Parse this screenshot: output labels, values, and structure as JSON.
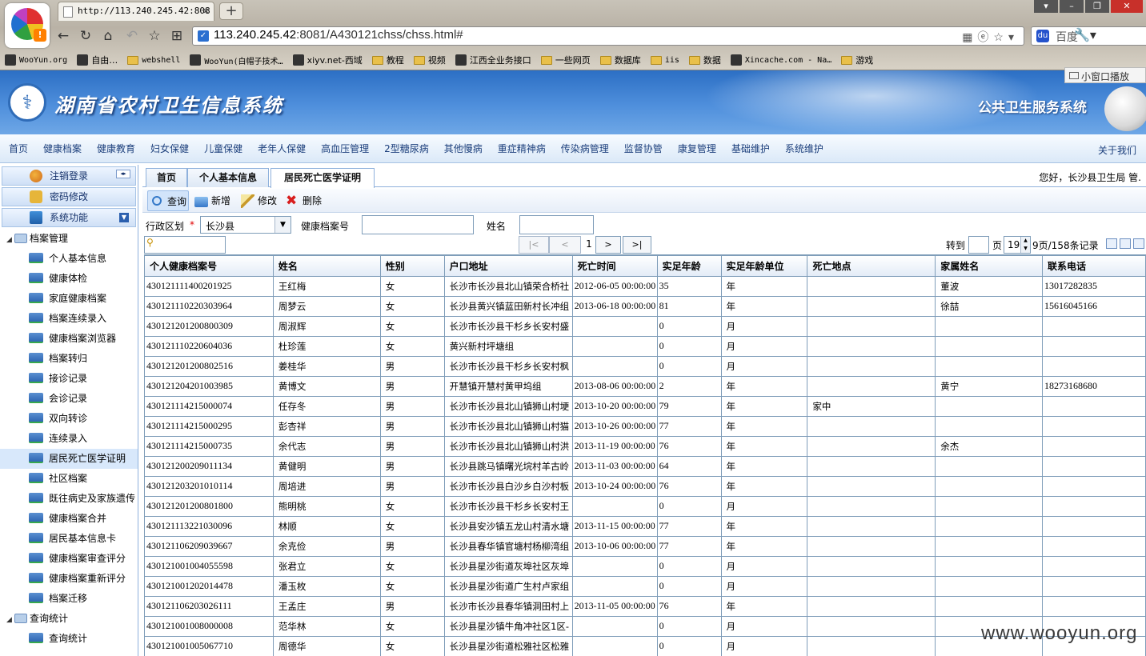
{
  "browser": {
    "tab_title": "http://113.240.245.42:808",
    "url_host": "113.240.245.42",
    "url_rest": ":8081/A430121chss/chss.html#",
    "search_placeholder": "百度",
    "bookmarks": [
      {
        "label": "WooYun.org",
        "type": "site",
        "mono": true
      },
      {
        "label": "自由…",
        "type": "site",
        "mono": false
      },
      {
        "label": "webshell",
        "type": "folder",
        "mono": true
      },
      {
        "label": "WooYun(白帽子技术…",
        "type": "site",
        "mono": true
      },
      {
        "label": "xiyv.net-西域",
        "type": "site",
        "mono": false
      },
      {
        "label": "教程",
        "type": "folder",
        "mono": false
      },
      {
        "label": "视频",
        "type": "folder",
        "mono": false
      },
      {
        "label": "江西全业务接口",
        "type": "site",
        "mono": false
      },
      {
        "label": "一些网页",
        "type": "folder",
        "mono": false
      },
      {
        "label": "数据库",
        "type": "folder",
        "mono": false
      },
      {
        "label": "iis",
        "type": "folder",
        "mono": true
      },
      {
        "label": "数据",
        "type": "folder",
        "mono": false
      },
      {
        "label": "Xincache.com - Na…",
        "type": "site",
        "mono": true
      },
      {
        "label": "游戏",
        "type": "folder",
        "mono": false
      }
    ],
    "mini_play": "小窗口播放"
  },
  "header": {
    "title": "湖南省农村卫生信息系统",
    "subtitle": "公共卫生服务系统"
  },
  "menu": {
    "items": [
      "首页",
      "健康档案",
      "健康教育",
      "妇女保健",
      "儿童保健",
      "老年人保健",
      "高血压管理",
      "2型糖尿病",
      "其他慢病",
      "重症精神病",
      "传染病管理",
      "监督协管",
      "康复管理",
      "基础维护",
      "系统维护"
    ],
    "about": "关于我们"
  },
  "sidebar": {
    "logout": "注销登录",
    "change_password": "密码修改",
    "system_functions": "系统功能",
    "group1": "档案管理",
    "items": [
      "个人基本信息",
      "健康体检",
      "家庭健康档案",
      "档案连续录入",
      "健康档案浏览器",
      "档案转归",
      "接诊记录",
      "会诊记录",
      "双向转诊",
      "连续录入",
      "居民死亡医学证明",
      "社区档案",
      "既往病史及家族遗传",
      "健康档案合并",
      "居民基本信息卡",
      "健康档案审查评分",
      "健康档案重新评分",
      "档案迁移"
    ],
    "selected_index": 10,
    "group2": "查询统计",
    "items2": [
      "查询统计"
    ]
  },
  "tabs": {
    "items": [
      "首页",
      "个人基本信息",
      "居民死亡医学证明"
    ],
    "active": 2,
    "welcome": "您好，长沙县卫生局 管."
  },
  "toolbar": {
    "query": "查询",
    "add": "新增",
    "edit": "修改",
    "delete": "删除"
  },
  "filter": {
    "district_label": "行政区划",
    "required_mark": "*",
    "district_value": "长沙县",
    "record_no_label": "健康档案号",
    "name_label": "姓名"
  },
  "pager": {
    "first": "|<",
    "prev": "<",
    "current": "1",
    "next": ">",
    "last": ">|",
    "goto_label": "转到",
    "page_label": "页",
    "page_value": "19",
    "records": "9页/158条记录"
  },
  "grid": {
    "columns": [
      "个人健康档案号",
      "姓名",
      "性别",
      "户口地址",
      "死亡时间",
      "实足年龄",
      "实足年龄单位",
      "死亡地点",
      "家属姓名",
      "联系电话"
    ],
    "rows": [
      [
        "430121111400201925",
        "王红梅",
        "女",
        "长沙市长沙县北山镇荣合桥社",
        "2012-06-05 00:00:00",
        "35",
        "年",
        "",
        "董波",
        "13017282835"
      ],
      [
        "430121110220303964",
        "周梦云",
        "女",
        "长沙县黄兴镇蓝田新村长冲组",
        "2013-06-18 00:00:00",
        "81",
        "年",
        "",
        "徐喆",
        "15616045166"
      ],
      [
        "430121201200800309",
        "周淑辉",
        "女",
        "长沙市长沙县干杉乡长安村盛",
        "",
        "0",
        "月",
        "",
        "",
        ""
      ],
      [
        "430121110220604036",
        "杜珍莲",
        "女",
        "黄兴新村坪塘组",
        "",
        "0",
        "月",
        "",
        "",
        ""
      ],
      [
        "430121201200802516",
        "姜桂华",
        "男",
        "长沙市长沙县干杉乡长安村枫",
        "",
        "0",
        "月",
        "",
        "",
        ""
      ],
      [
        "430121204201003985",
        "黄博文",
        "男",
        "开慧镇开慧村黄甲坞组",
        "2013-08-06 00:00:00",
        "2",
        "年",
        "",
        "黄宁",
        "18273168680"
      ],
      [
        "430121114215000074",
        "任存冬",
        "男",
        "长沙市长沙县北山镇狮山村埂",
        "2013-10-20 00:00:00",
        "79",
        "年",
        "家中",
        "",
        ""
      ],
      [
        "430121114215000295",
        "彭杏祥",
        "男",
        "长沙市长沙县北山镇狮山村猫",
        "2013-10-26 00:00:00",
        "77",
        "年",
        "",
        "",
        ""
      ],
      [
        "430121114215000735",
        "余代志",
        "男",
        "长沙市长沙县北山镇狮山村洪",
        "2013-11-19 00:00:00",
        "76",
        "年",
        "",
        "余杰",
        ""
      ],
      [
        "430121200209011134",
        "黄健明",
        "男",
        "长沙县跳马镇曙光垸村羊古岭",
        "2013-11-03 00:00:00",
        "64",
        "年",
        "",
        "",
        ""
      ],
      [
        "430121203201010114",
        "周培进",
        "男",
        "长沙市长沙县白沙乡白沙村板",
        "2013-10-24 00:00:00",
        "76",
        "年",
        "",
        "",
        ""
      ],
      [
        "430121201200801800",
        "熊明桃",
        "女",
        "长沙市长沙县干杉乡长安村王",
        "",
        "0",
        "月",
        "",
        "",
        ""
      ],
      [
        "430121113221030096",
        "林顺",
        "女",
        "长沙县安沙镇五龙山村清水塘",
        "2013-11-15 00:00:00",
        "77",
        "年",
        "",
        "",
        ""
      ],
      [
        "430121106209039667",
        "余克俭",
        "男",
        "长沙县春华镇官塘村杨柳湾组",
        "2013-10-06 00:00:00",
        "77",
        "年",
        "",
        "",
        ""
      ],
      [
        "430121001004055598",
        "张君立",
        "女",
        "长沙县星沙街道灰埠社区灰埠",
        "",
        "0",
        "月",
        "",
        "",
        ""
      ],
      [
        "430121001202014478",
        "潘玉枚",
        "女",
        "长沙县星沙街道广生村卢家组",
        "",
        "0",
        "月",
        "",
        "",
        ""
      ],
      [
        "430121106203026111",
        "王孟庄",
        "男",
        "长沙市长沙县春华镇洞田村上",
        "2013-11-05 00:00:00",
        "76",
        "年",
        "",
        "",
        ""
      ],
      [
        "430121001008000008",
        "范华林",
        "女",
        "长沙县星沙镇牛角冲社区1区-",
        "",
        "0",
        "月",
        "",
        "",
        ""
      ],
      [
        "430121001005067710",
        "周德华",
        "女",
        "长沙县星沙街道松雅社区松雅",
        "",
        "0",
        "月",
        "",
        "",
        ""
      ]
    ]
  },
  "watermark": "www.wooyun.org"
}
